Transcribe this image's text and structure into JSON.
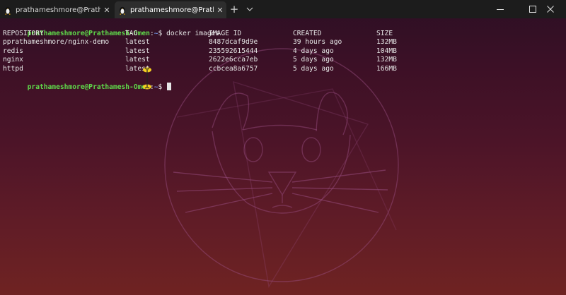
{
  "tabs": [
    {
      "label": "prathameshmore@Prathamesh-Omen: ~",
      "icon": "tux-icon",
      "active": false
    },
    {
      "label": "prathameshmore@Prathamesh-Omen: ~",
      "icon": "tux-icon",
      "active": true
    }
  ],
  "titlebar": {
    "new_tab": "+",
    "dropdown": "chevron-down-icon"
  },
  "window_controls": [
    "minimize-icon",
    "maximize-icon",
    "close-icon"
  ],
  "terminal": {
    "prompt_user": "prathameshmore@Prathamesh-Omen",
    "prompt_sep": ":",
    "prompt_path": "~",
    "prompt_dollar": "$ ",
    "command": "docker images",
    "headers": [
      "REPOSITORY",
      "TAG",
      "IMAGE ID",
      "CREATED",
      "SIZE"
    ],
    "rows": [
      [
        "pprathameshmore/nginx-demo",
        "latest",
        "8487dcaf9d9e",
        "39 hours ago",
        "132MB"
      ],
      [
        "redis",
        "latest",
        "235592615444",
        "4 days ago",
        "104MB"
      ],
      [
        "nginx",
        "latest",
        "2622e6cca7eb",
        "5 days ago",
        "132MB"
      ],
      [
        "httpd",
        "latest",
        "ccbcea8a6757",
        "5 days ago",
        "166MB"
      ]
    ]
  },
  "colors": {
    "prompt_user": "#5fd94a",
    "prompt_path": "#6f8dd8",
    "text": "#e6e6e6",
    "background_top": "#2c0f24",
    "background_bottom": "#6f2322"
  }
}
